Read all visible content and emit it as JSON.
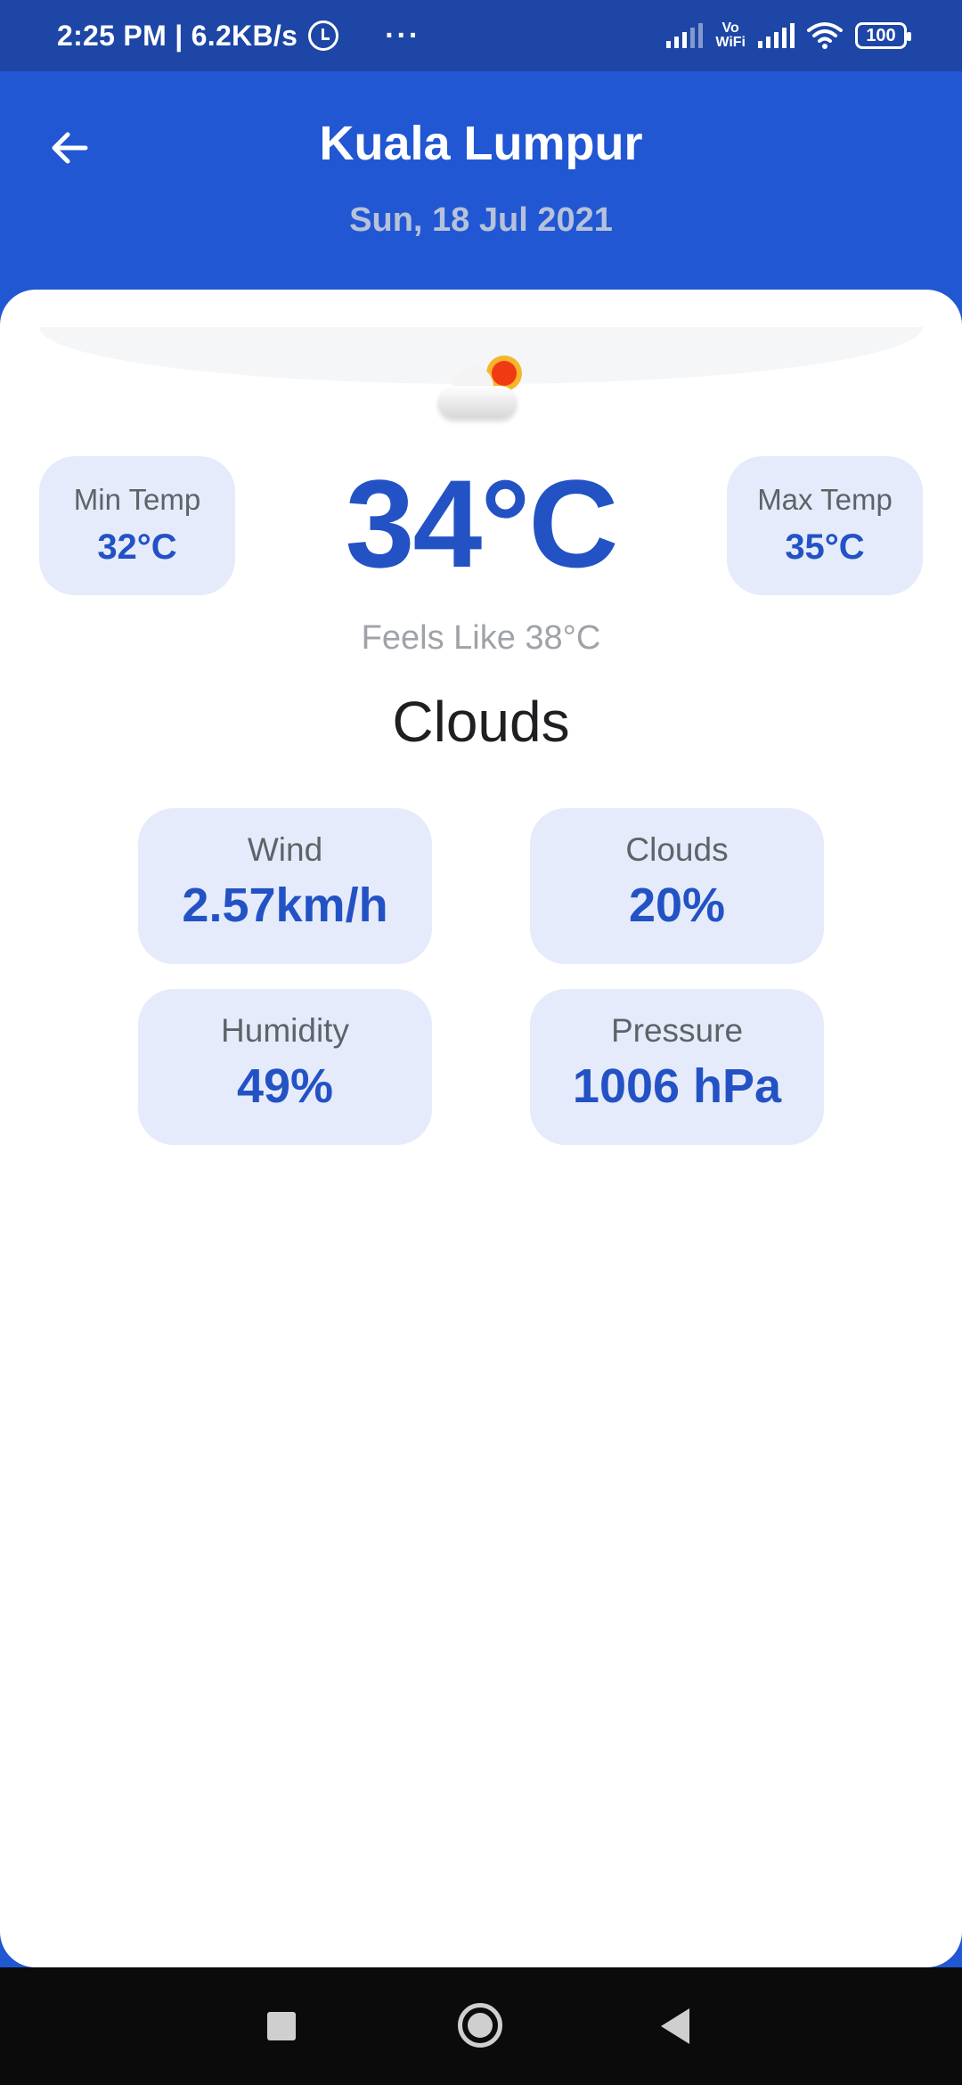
{
  "status_bar": {
    "time": "2:25 PM | 6.2KB/s",
    "more": "···",
    "vowifi_top": "Vo",
    "vowifi_bottom": "WiFi",
    "battery": "100"
  },
  "header": {
    "city": "Kuala Lumpur",
    "date": "Sun, 18 Jul 2021",
    "back_icon": "arrow-left-icon"
  },
  "weather": {
    "icon": "partly-cloudy-icon",
    "min_label": "Min Temp",
    "min_value": "32°C",
    "max_label": "Max Temp",
    "max_value": "35°C",
    "current_temp": "34°C",
    "feels_like": "Feels Like 38°C",
    "condition": "Clouds"
  },
  "metrics": {
    "wind": {
      "label": "Wind",
      "value": "2.57km/h"
    },
    "clouds": {
      "label": "Clouds",
      "value": "20%"
    },
    "humidity": {
      "label": "Humidity",
      "value": "49%"
    },
    "pressure": {
      "label": "Pressure",
      "value": "1006 hPa"
    }
  },
  "colors": {
    "header_blue": "#2157d2",
    "status_blue": "#1d46a6",
    "accent_blue": "#2352c5",
    "card_tint": "#e5ebfa"
  }
}
